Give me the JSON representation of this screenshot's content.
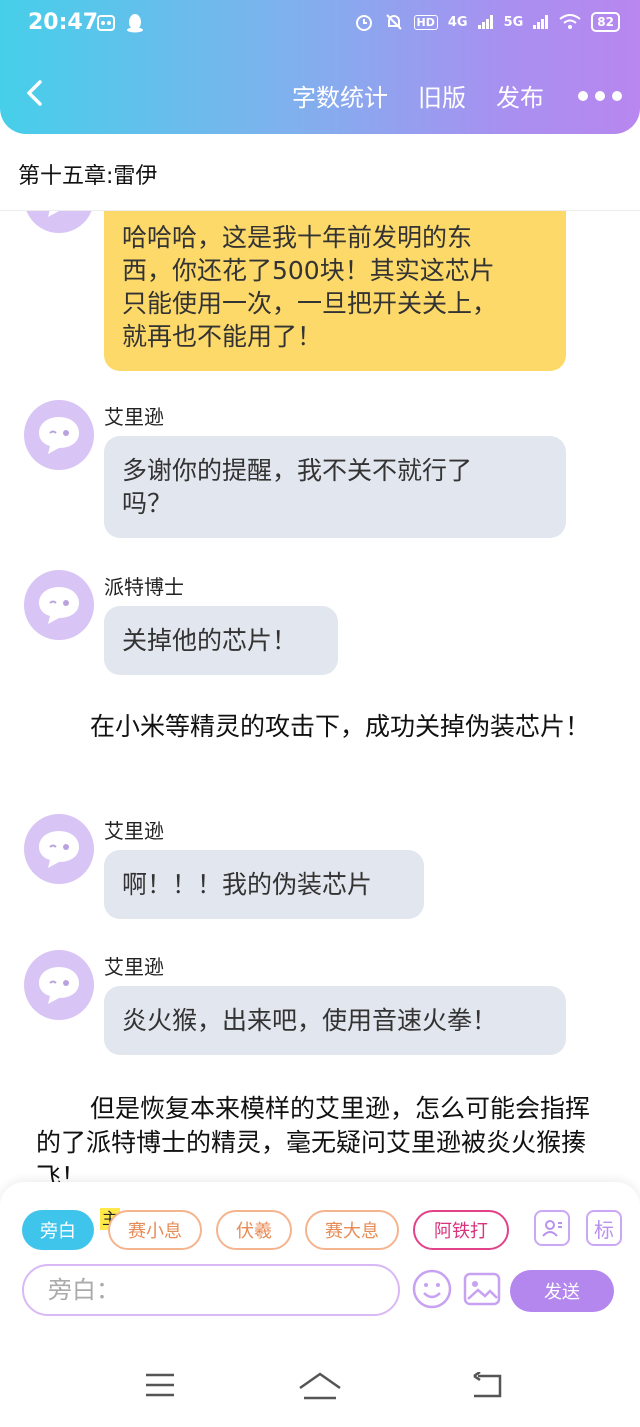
{
  "status_bar": {
    "time": "20:47",
    "battery": "82",
    "net1": "4G",
    "net2": "5G",
    "hd": "HD"
  },
  "app_bar": {
    "word_count_label": "字数统计",
    "old_version_label": "旧版",
    "publish_label": "发布"
  },
  "chapter": {
    "title": "第十五章:雷伊"
  },
  "messages": [
    {
      "type": "bubble",
      "speaker": "",
      "text": "哈哈哈，这是我十年前发明的东西，你还花了500块！其实这芯片只能使用一次，一旦把开关关上，就再也不能用了！",
      "lines": [
        "哈哈哈，这是我十年前发明的东",
        "西，你还花了500块！其实这芯片",
        "只能使用一次，一旦把开关关上，",
        "就再也不能用了！"
      ]
    },
    {
      "type": "bubble",
      "speaker": "艾里逊",
      "lines": [
        "多谢你的提醒，我不关不就行了",
        "吗？"
      ]
    },
    {
      "type": "bubble",
      "speaker": "派特博士",
      "lines": [
        "关掉他的芯片！"
      ]
    },
    {
      "type": "narration",
      "text": "在小米等精灵的攻击下，成功关掉伪装芯片！"
    },
    {
      "type": "bubble",
      "speaker": "艾里逊",
      "lines": [
        "啊！！！我的伪装芯片"
      ]
    },
    {
      "type": "bubble",
      "speaker": "艾里逊",
      "lines": [
        "炎火猴，出来吧，使用音速火拳！"
      ]
    },
    {
      "type": "narration",
      "text": "但是恢复本来模样的艾里逊，怎么可能会指挥的了派特博士的精灵，毫无疑问艾里逊被炎火猴揍飞！"
    }
  ],
  "toolbar": {
    "narrator_chip": "旁白",
    "main_tag": "主",
    "roles": [
      "赛小息",
      "伏羲",
      "赛大息",
      "阿铁打"
    ],
    "role_icon_label": "标",
    "input_placeholder": "旁白：",
    "send_label": "发送"
  },
  "colors": {
    "accent": "#b487ef",
    "narrator": "#3fc4ec",
    "yellow_bubble": "#fdd96a",
    "grey_bubble": "#e2e6ee"
  }
}
